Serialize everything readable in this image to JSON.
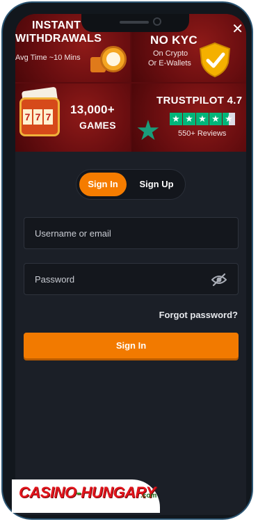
{
  "promo": {
    "tiles": [
      {
        "title": "INSTANT\nWITHDRAWALS",
        "line1": "INSTANT",
        "line2": "WITHDRAWALS",
        "sub": "Avg Time ~10 Mins"
      },
      {
        "title": "NO KYC",
        "sub1": "On Crypto",
        "sub2": "Or E-Wallets"
      },
      {
        "title": "13,000+",
        "sub": "GAMES"
      },
      {
        "title": "TRUSTPILOT 4.7",
        "sub": "550+ Reviews",
        "rating": 4.7
      }
    ],
    "close_icon": "close-icon"
  },
  "auth_tabs": {
    "sign_in": "Sign In",
    "sign_up": "Sign Up",
    "active": "sign_in"
  },
  "form": {
    "username_placeholder": "Username or email",
    "password_placeholder": "Password",
    "forgot": "Forgot password?",
    "submit": "Sign In"
  },
  "watermark": {
    "text_main": "CASINO",
    "text_sep": "-",
    "text_brand": "HUNGARY",
    "suffix": ".com"
  },
  "colors": {
    "accent": "#f57c00",
    "background": "#1b1f27",
    "promo": "#6a0e10",
    "trustpilot": "#00b67a"
  }
}
